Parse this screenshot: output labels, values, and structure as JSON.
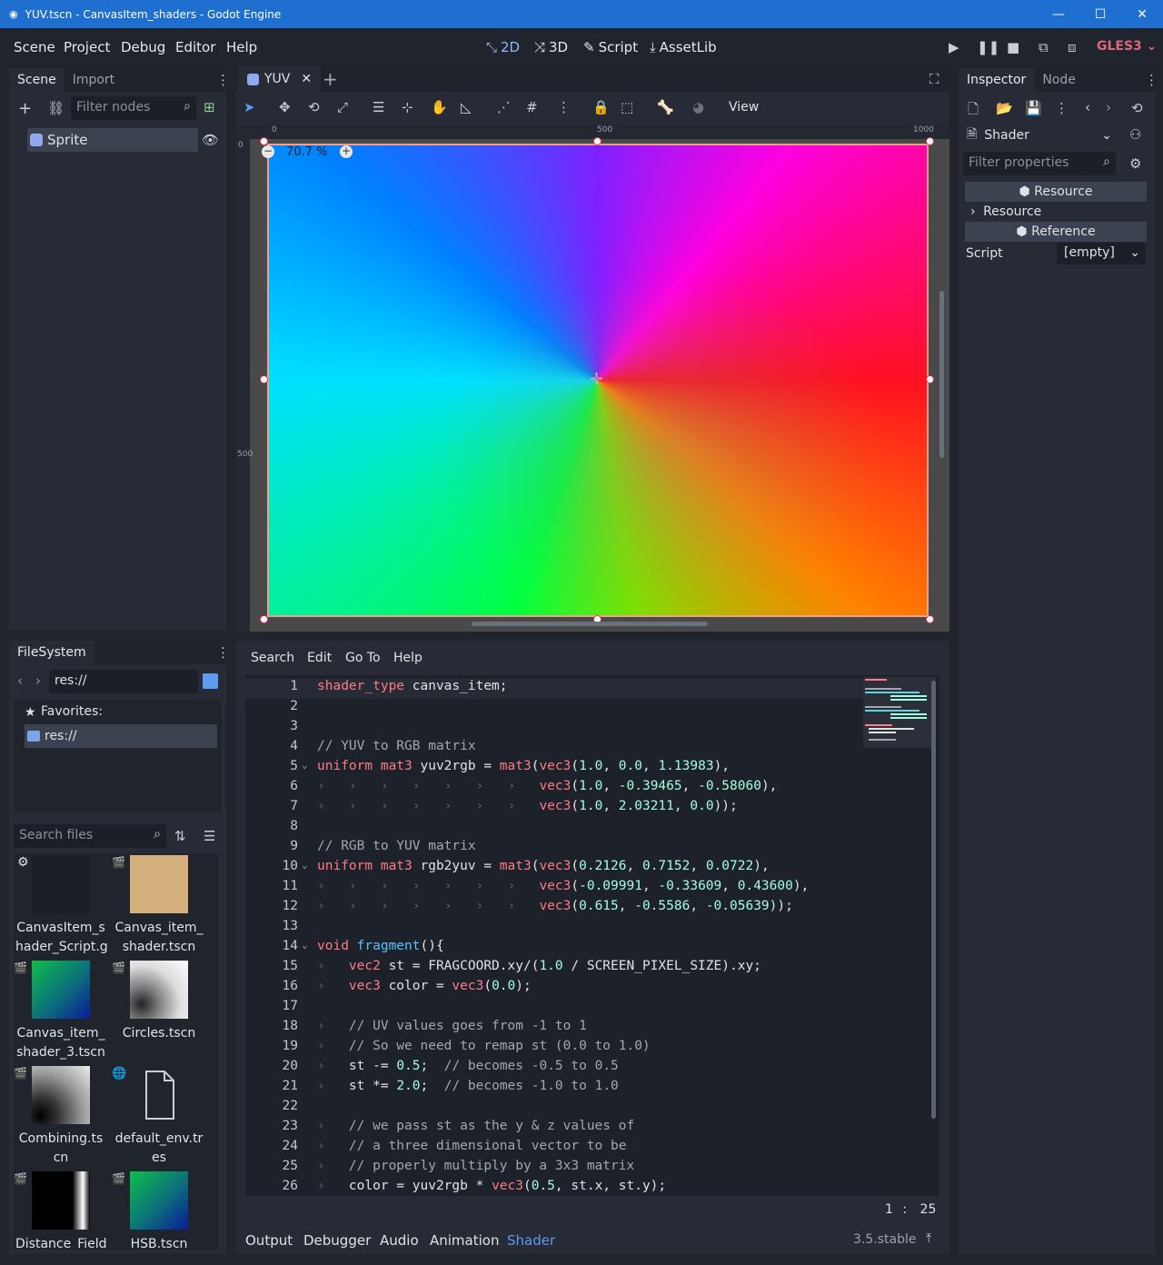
{
  "window": {
    "title": "YUV.tscn - CanvasItem_shaders - Godot Engine"
  },
  "menubar": {
    "menus": [
      "Scene",
      "Project",
      "Debug",
      "Editor",
      "Help"
    ],
    "workspaces": [
      {
        "label": "2D",
        "active": true
      },
      {
        "label": "3D",
        "active": false
      },
      {
        "label": "Script",
        "active": false
      },
      {
        "label": "AssetLib",
        "active": false
      }
    ],
    "renderer": "GLES3"
  },
  "scene_dock": {
    "tabs": [
      "Scene",
      "Import"
    ],
    "filter_placeholder": "Filter nodes",
    "node": "Sprite"
  },
  "filesystem": {
    "title": "FileSystem",
    "path": "res://",
    "favorites_label": "Favorites:",
    "root": "res://",
    "search_placeholder": "Search files",
    "files": [
      {
        "name": "CanvasItem_s hader_Script.g",
        "line1": "CanvasItem_s",
        "line2": "hader_Script.g"
      },
      {
        "name": "Canvas_item_ shader.tscn",
        "line1": "Canvas_item_",
        "line2": "shader.tscn"
      },
      {
        "name": "Canvas_item_ shader_3.tscn",
        "line1": "Canvas_item_",
        "line2": "shader_3.tscn"
      },
      {
        "name": "Circles.tscn",
        "line1": "Circles.tscn",
        "line2": ""
      },
      {
        "name": "Combining.ts cn",
        "line1": "Combining.ts",
        "line2": "cn"
      },
      {
        "name": "default_env.tr es",
        "line1": "default_env.tr",
        "line2": "es"
      },
      {
        "name": "Distance_Field",
        "line1": "Distance_Field",
        "line2": ""
      },
      {
        "name": "HSB.tscn",
        "line1": "HSB.tscn",
        "line2": ""
      }
    ]
  },
  "viewport": {
    "scene_tab": "YUV",
    "view_menu": "View",
    "zoom": "70.7 %",
    "ruler": {
      "top": [
        "0",
        "500",
        "1000"
      ],
      "left": [
        "0",
        "500"
      ]
    }
  },
  "script_editor": {
    "menus": [
      "Search",
      "Edit",
      "Go To",
      "Help"
    ],
    "cursor": {
      "line": "1",
      "sep": ":",
      "col": "25"
    },
    "lines": [
      "1",
      "2",
      "3",
      "4",
      "5",
      "6",
      "7",
      "8",
      "9",
      "10",
      "11",
      "12",
      "13",
      "14",
      "15",
      "16",
      "17",
      "18",
      "19",
      "20",
      "21",
      "22",
      "23",
      "24",
      "25",
      "26"
    ]
  },
  "bottom_panel": {
    "tabs": [
      "Output",
      "Debugger",
      "Audio",
      "Animation",
      "Shader"
    ],
    "active": "Shader",
    "version": "3.5.stable"
  },
  "inspector": {
    "tabs": [
      "Inspector",
      "Node"
    ],
    "object": "Shader",
    "filter_placeholder": "Filter properties",
    "section_resource": "Resource",
    "subsection_resource": "Resource",
    "section_reference": "Reference",
    "script_label": "Script",
    "script_value": "[empty]"
  },
  "colors": {
    "accent": "#5d9cf2",
    "titlebar": "#1f6fd1",
    "renderer": "#e0647c"
  }
}
